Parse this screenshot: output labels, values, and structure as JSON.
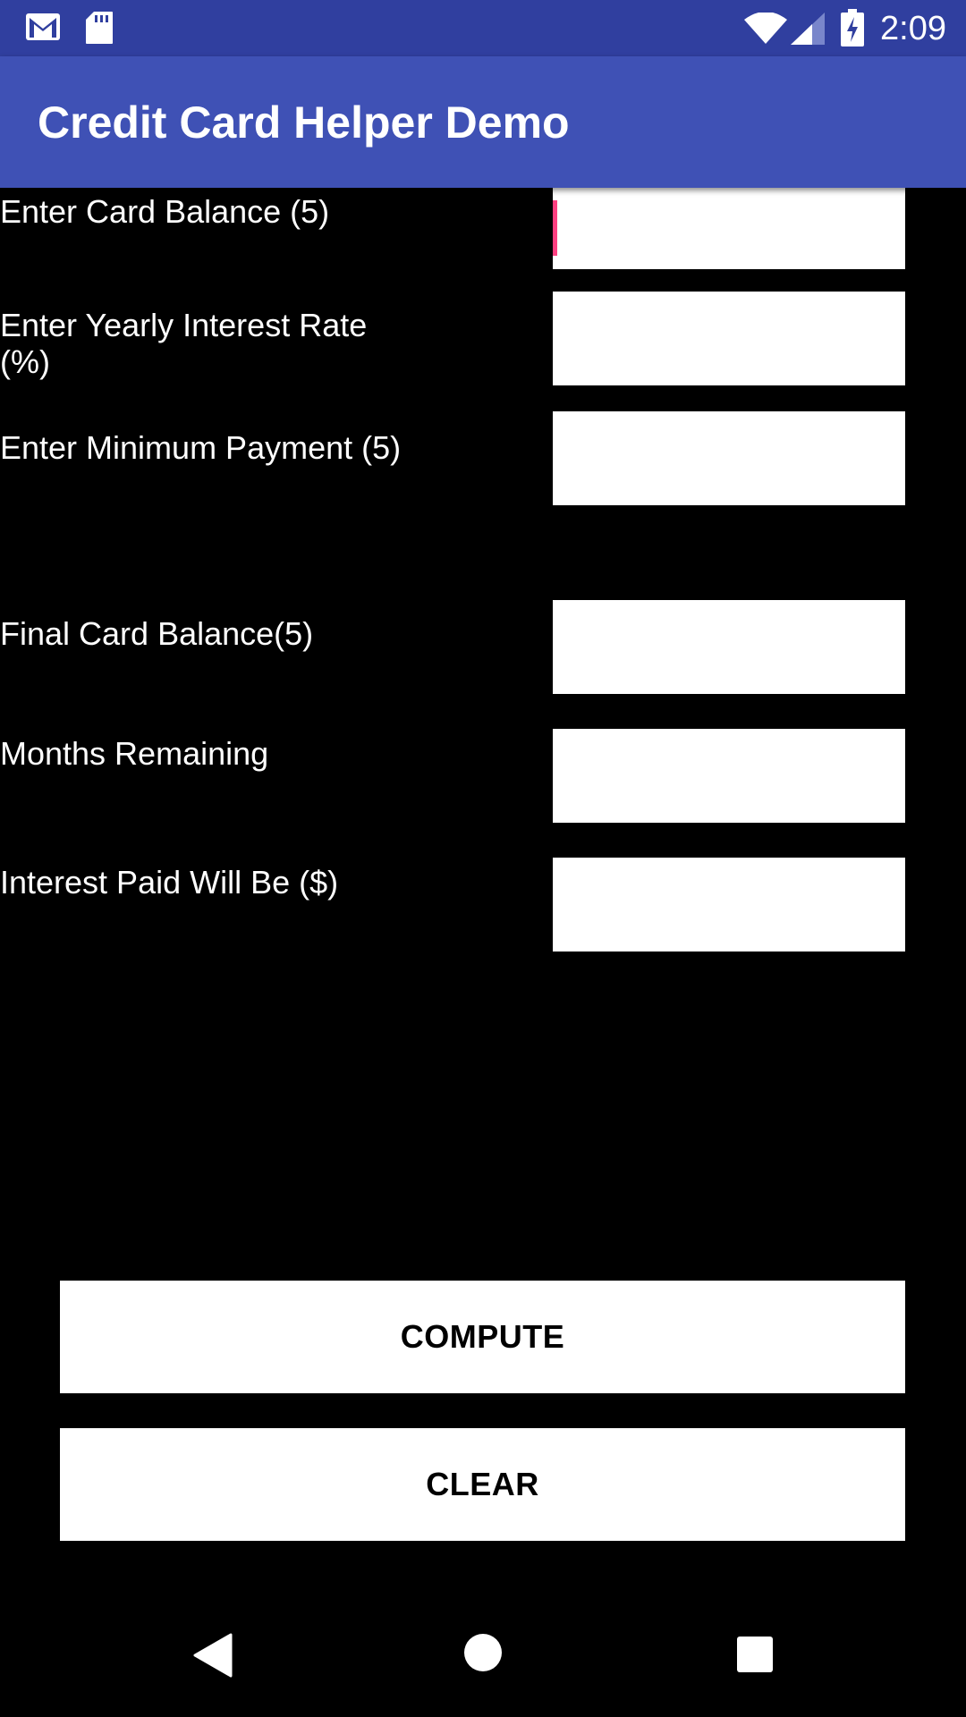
{
  "status_bar": {
    "time": "2:09",
    "icons": [
      "gmail-icon",
      "sd-card-icon",
      "wifi-icon",
      "signal-icon",
      "battery-charging-icon"
    ],
    "background": "#303F9F"
  },
  "app_bar": {
    "title": "Credit Card Helper Demo",
    "background": "#3F51B5"
  },
  "form": {
    "fields": [
      {
        "label": "Enter Card Balance (5)",
        "value": "",
        "placeholder": ""
      },
      {
        "label": "Enter Yearly Interest Rate (%)",
        "value": "",
        "placeholder": ""
      },
      {
        "label": "Enter Minimum Payment (5)",
        "value": "",
        "placeholder": ""
      },
      {
        "label": "Final Card Balance(5)",
        "value": "",
        "placeholder": ""
      },
      {
        "label": "Months Remaining",
        "value": "",
        "placeholder": ""
      },
      {
        "label": "Interest Paid Will Be ($)",
        "value": "",
        "placeholder": ""
      }
    ],
    "cursor_color": "#FF4081"
  },
  "buttons": {
    "compute": "COMPUTE",
    "clear": "CLEAR"
  },
  "nav_bar": {
    "icons": [
      "back-icon",
      "home-icon",
      "recents-icon"
    ]
  }
}
